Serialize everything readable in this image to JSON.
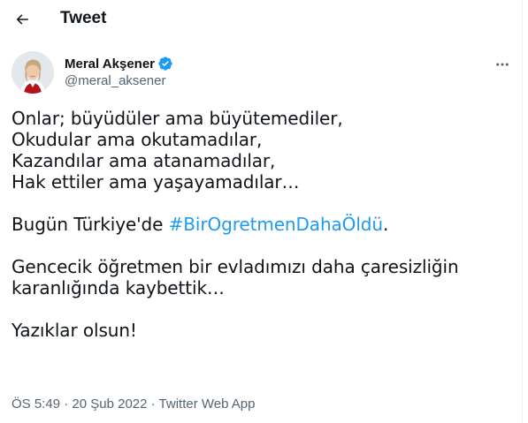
{
  "header": {
    "title": "Tweet",
    "back_icon": "arrow-left-icon"
  },
  "author": {
    "name": "Meral Akşener",
    "handle": "@meral_aksener",
    "verified": true,
    "verified_color": "#1d9bf0"
  },
  "tweet": {
    "lines": [
      "Onlar; büyüdüler ama büyütemediler,",
      "Okudular ama okutamadılar,",
      "Kazandılar ama atanamadılar,",
      "Hak ettiler ama yaşayamadılar…"
    ],
    "p2_prefix": "Bugün Türkiye'de ",
    "hashtag": "#BirOgretmenDahaÖldü",
    "p2_suffix": ".",
    "p3_lines": [
      "Gencecik öğretmen bir evladımızı daha çaresizliğin",
      "karanlığında kaybettik…"
    ],
    "p4": "Yazıklar olsun!"
  },
  "meta": {
    "time": "ÖS 5:49",
    "date": "20 Şub 2022",
    "source": "Twitter Web App",
    "separator": "·"
  },
  "colors": {
    "text": "#0f1419",
    "secondary": "#536471",
    "accent": "#1d9bf0"
  }
}
